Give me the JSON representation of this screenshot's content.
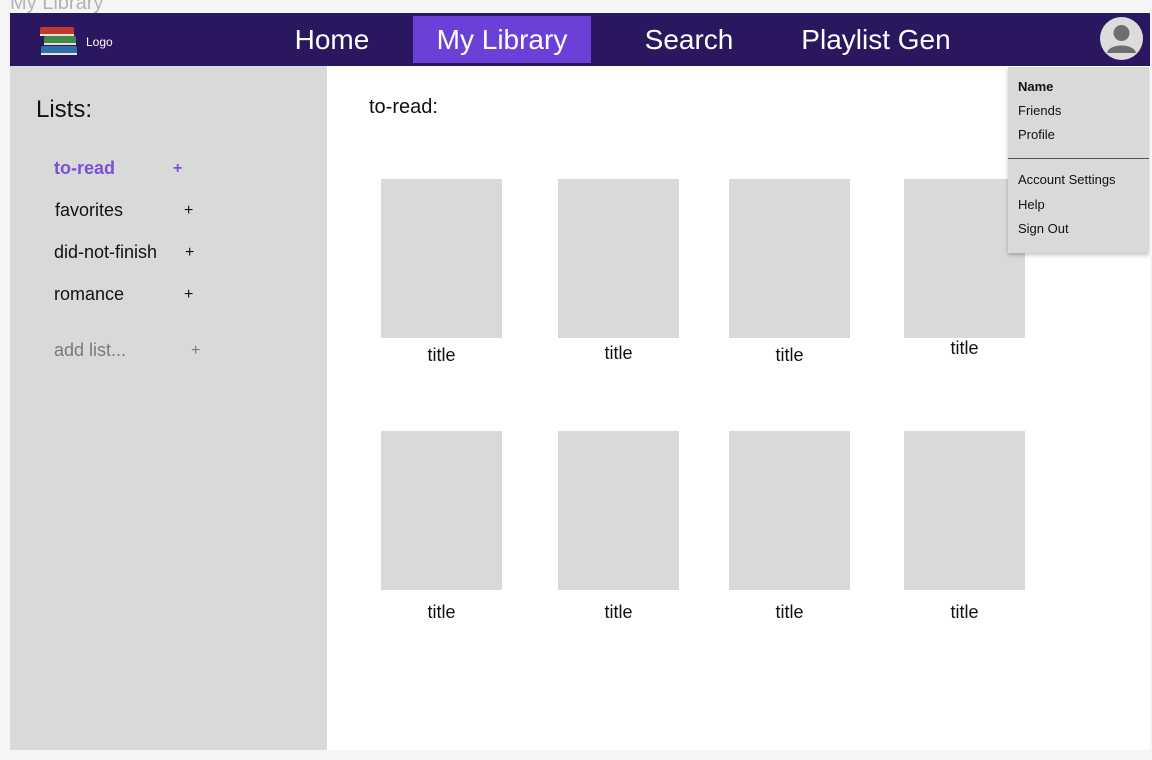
{
  "frame": {
    "label": "My Library"
  },
  "navbar": {
    "logo_text": "Logo",
    "items": [
      {
        "label": "Home"
      },
      {
        "label": "My Library"
      },
      {
        "label": "Search"
      },
      {
        "label": "Playlist Gen"
      }
    ],
    "active_index": 1
  },
  "sidebar": {
    "title": "Lists:",
    "lists": [
      {
        "label": "to-read",
        "plus": "+"
      },
      {
        "label": "favorites",
        "plus": "+"
      },
      {
        "label": "did-not-finish",
        "plus": "+"
      },
      {
        "label": "romance",
        "plus": "+"
      }
    ],
    "add_list": {
      "label": "add list...",
      "plus": "+"
    }
  },
  "main": {
    "heading": "to-read:",
    "books": [
      {
        "title": "title"
      },
      {
        "title": "title"
      },
      {
        "title": "title"
      },
      {
        "title": "title"
      },
      {
        "title": "title"
      },
      {
        "title": "title"
      },
      {
        "title": "title"
      },
      {
        "title": "title"
      }
    ]
  },
  "user_menu": {
    "name": "Name",
    "items_top": [
      "Friends",
      "Profile"
    ],
    "items_bottom": [
      "Account Settings",
      "Help",
      "Sign Out"
    ]
  },
  "colors": {
    "navbar": "#2a1760",
    "nav_active": "#6b40d8",
    "accent": "#7b4fd6",
    "placeholder": "#d9d9d9"
  }
}
